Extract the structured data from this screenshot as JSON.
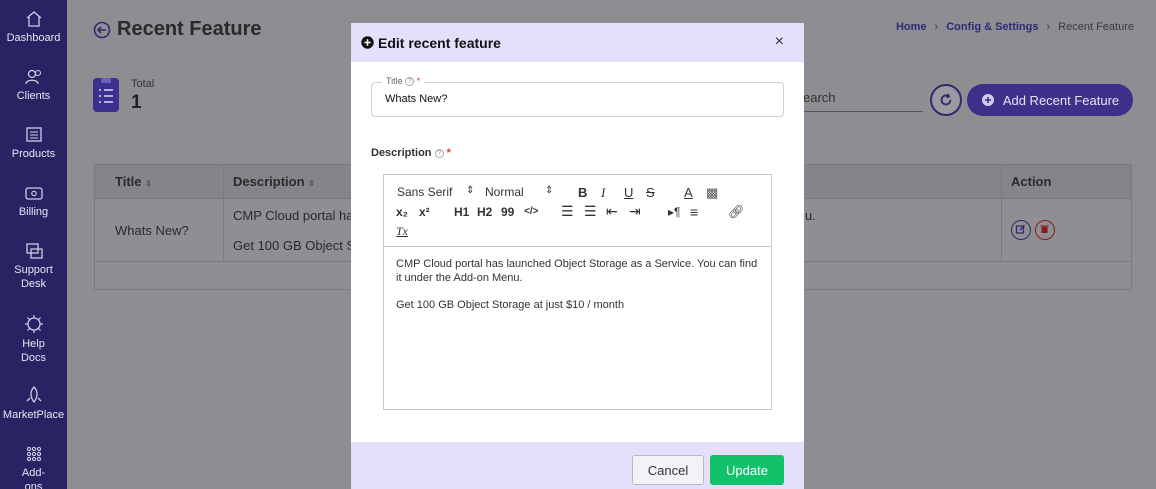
{
  "sidebar": {
    "items": [
      {
        "label": "Dashboard",
        "icon": "home-icon"
      },
      {
        "label": "Clients",
        "icon": "users-icon"
      },
      {
        "label": "Products",
        "icon": "products-icon"
      },
      {
        "label": "Billing",
        "icon": "billing-icon"
      },
      {
        "label": "Support Desk",
        "icon": "support-icon"
      },
      {
        "label": "Help Docs",
        "icon": "help-docs-icon"
      },
      {
        "label": "MarketPlace",
        "icon": "marketplace-icon"
      },
      {
        "label": "Add-ons",
        "icon": "addons-icon"
      }
    ]
  },
  "page": {
    "title": "Recent Feature",
    "breadcrumb": [
      "Home",
      "Config & Settings",
      "Recent Feature"
    ],
    "stat_label": "Total",
    "stat_value": "1",
    "search_placeholder": "earch",
    "add_button": "Add Recent Feature"
  },
  "table": {
    "headers": [
      "Title",
      "Description",
      "Action"
    ],
    "row": {
      "title": "Whats New?",
      "desc_line1": "CMP Cloud portal has",
      "desc_line2": "Get 100 GB Object St",
      "desc_tail": "u."
    }
  },
  "modal": {
    "header": "Edit recent feature",
    "close": "×",
    "title_label": "Title",
    "title_value": "Whats New?",
    "description_label": "Description",
    "toolbar": {
      "font": "Sans Serif",
      "size": "Normal",
      "bold": "B",
      "italic": "I",
      "underline": "U",
      "strike": "S",
      "color": "A",
      "sub": "x₂",
      "sup": "x²",
      "h1": "H1",
      "h2": "H2",
      "quote": "99",
      "code": "</>",
      "clear": "Tx"
    },
    "body_para1": "CMP Cloud portal has launched Object Storage as a Service. You can find it under the Add-on Menu.",
    "body_para2": "Get 100 GB Object Storage at just $10 / month",
    "cancel": "Cancel",
    "update": "Update"
  },
  "colors": {
    "sidebar": "#2a2363",
    "modal_header": "#e4e0fb",
    "update": "#11c26a",
    "accent": "#3d308a"
  }
}
